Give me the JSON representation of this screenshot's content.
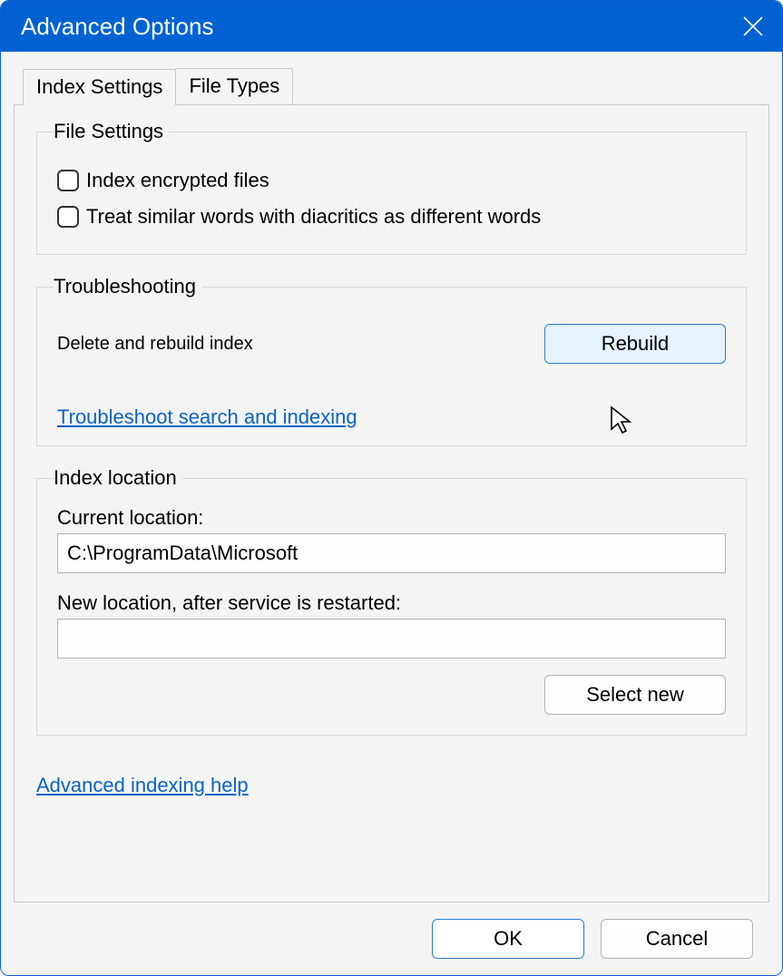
{
  "title": "Advanced Options",
  "tabs": {
    "index_settings": "Index Settings",
    "file_types": "File Types"
  },
  "file_settings": {
    "legend": "File Settings",
    "encrypt_label": "Index encrypted files",
    "diacritics_label": "Treat similar words with diacritics as different words",
    "encrypt_checked": false,
    "diacritics_checked": false
  },
  "troubleshooting": {
    "legend": "Troubleshooting",
    "delete_rebuild_label": "Delete and rebuild index",
    "rebuild_button": "Rebuild",
    "troubleshoot_link": "Troubleshoot search and indexing"
  },
  "index_location": {
    "legend": "Index location",
    "current_label": "Current location:",
    "current_value": "C:\\ProgramData\\Microsoft",
    "new_label": "New location, after service is restarted:",
    "new_value": "",
    "select_new_button": "Select new"
  },
  "advanced_help_link": "Advanced indexing help",
  "footer": {
    "ok": "OK",
    "cancel": "Cancel"
  }
}
